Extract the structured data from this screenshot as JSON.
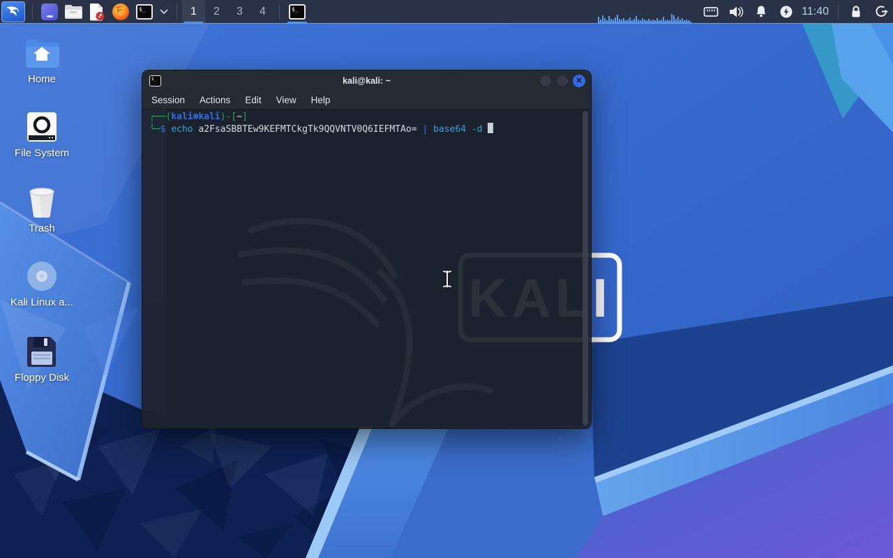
{
  "wallpaper": {
    "watermark_text": "KALI"
  },
  "panel": {
    "launchers": [
      {
        "name": "kali-menu",
        "icon": "kali-dragon-icon"
      },
      {
        "name": "window-app",
        "icon": "window-app-icon"
      },
      {
        "name": "file-manager",
        "icon": "folder-icon"
      },
      {
        "name": "text-editor",
        "icon": "document-edit-icon"
      },
      {
        "name": "firefox",
        "icon": "firefox-icon"
      },
      {
        "name": "terminal-launcher",
        "icon": "terminal-icon"
      },
      {
        "name": "terminal-dropdown",
        "icon": "chevron-down-icon"
      }
    ],
    "workspaces": {
      "items": [
        "1",
        "2",
        "3",
        "4"
      ],
      "active_index": 0
    },
    "taskbar": [
      {
        "name": "terminal-window",
        "icon": "terminal-icon",
        "active": true
      }
    ],
    "cpu_graph_bars": [
      7,
      3,
      9,
      5,
      2,
      8,
      4,
      3,
      6,
      10,
      4,
      3,
      5,
      2,
      3,
      6,
      2,
      4,
      8,
      3,
      2,
      5,
      3,
      2,
      4,
      2,
      3,
      2,
      5,
      2,
      3,
      7,
      2,
      3,
      2,
      11,
      9,
      4,
      7,
      3,
      5,
      2,
      3,
      2
    ],
    "tray_icons": [
      "ethernet-icon",
      "volume-icon",
      "notifications-icon",
      "power-manager-icon"
    ],
    "clock": "11:40",
    "session_icons": [
      "lock-icon",
      "logout-icon"
    ],
    "colors": {
      "panel_bg": "#293247",
      "panel_border": "#6b9bdd",
      "graph_bar": "#5aa0ec",
      "accent_underline": "#4f94e8"
    }
  },
  "desktop_icons": [
    {
      "label": "Home",
      "icon": "home-folder-icon"
    },
    {
      "label": "File System",
      "icon": "drive-icon"
    },
    {
      "label": "Trash",
      "icon": "trash-icon"
    },
    {
      "label": "Kali Linux a...",
      "icon": "disc-icon"
    },
    {
      "label": "Floppy Disk",
      "icon": "floppy-icon"
    }
  ],
  "window": {
    "title": "kali@kali: ~",
    "titlebar_icon": "terminal-icon",
    "buttons": [
      "minimize",
      "maximize",
      "close"
    ],
    "close_glyph": "✕",
    "menu": [
      "Session",
      "Actions",
      "Edit",
      "View",
      "Help"
    ],
    "colors": {
      "close_button": "#2e6be5",
      "chrome_bg": "#262a33"
    },
    "terminal": {
      "colors": {
        "green": "#2ea84f",
        "userblue": "#2d72e4",
        "cmd": "#3d9fd6",
        "fg": "#d6d9df",
        "cursor": "#c9cdd5"
      },
      "lines": [
        {
          "segments": [
            {
              "text": "┌──(",
              "c": "green"
            },
            {
              "text": "kali⊛kali",
              "c": "userblue",
              "bold": true
            },
            {
              "text": ")-[",
              "c": "green"
            },
            {
              "text": "~",
              "c": "fg"
            },
            {
              "text": "]",
              "c": "green"
            }
          ]
        },
        {
          "segments": [
            {
              "text": "└─",
              "c": "green"
            },
            {
              "text": "$",
              "c": "userblue"
            },
            {
              "text": " ",
              "c": "fg"
            },
            {
              "text": "echo",
              "c": "cmd"
            },
            {
              "text": " a2FsaSBBTEw9KEFMTCkgTk9QQVNTV0Q6IEFMTAo= ",
              "c": "fg"
            },
            {
              "text": "|",
              "c": "userblue"
            },
            {
              "text": " ",
              "c": "fg"
            },
            {
              "text": "base64",
              "c": "cmd"
            },
            {
              "text": " ",
              "c": "fg"
            },
            {
              "text": "-d",
              "c": "cmd"
            },
            {
              "text": " ",
              "c": "fg"
            }
          ],
          "cursor": true
        }
      ]
    }
  }
}
